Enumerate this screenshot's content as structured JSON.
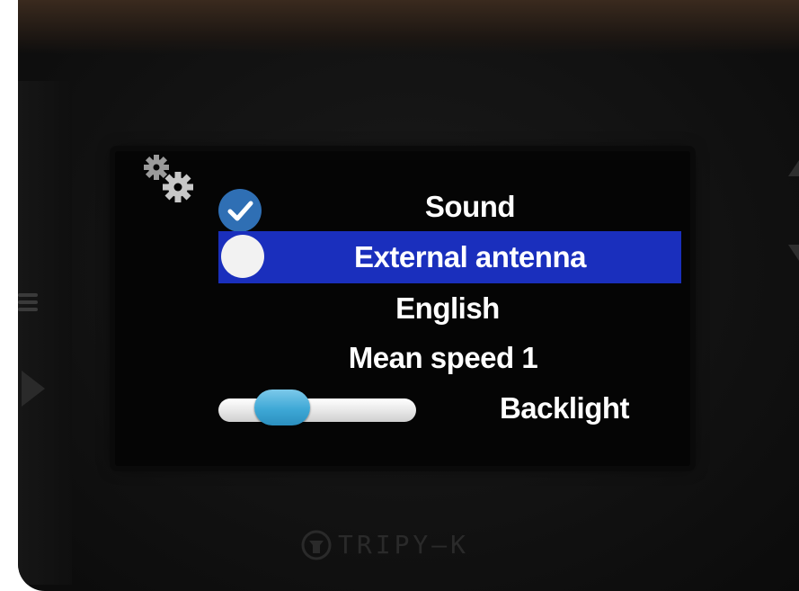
{
  "screen": {
    "settings_icon": "gears-icon",
    "menu": [
      {
        "label": "Sound",
        "control": "checkbox",
        "checked": true
      },
      {
        "label": "External antenna",
        "control": "radio",
        "checked": false,
        "selected": true
      },
      {
        "label": "English",
        "control": "none"
      },
      {
        "label": "Mean speed 1",
        "control": "none"
      },
      {
        "label": "Backlight",
        "control": "slider",
        "value": 0.25
      }
    ]
  },
  "device": {
    "brand": "TRIPY—K"
  },
  "colors": {
    "highlight": "#1a2fbd",
    "check_blue": "#2f6fb4",
    "slider_knob": "#3ea8d6",
    "text": "#ffffff"
  }
}
